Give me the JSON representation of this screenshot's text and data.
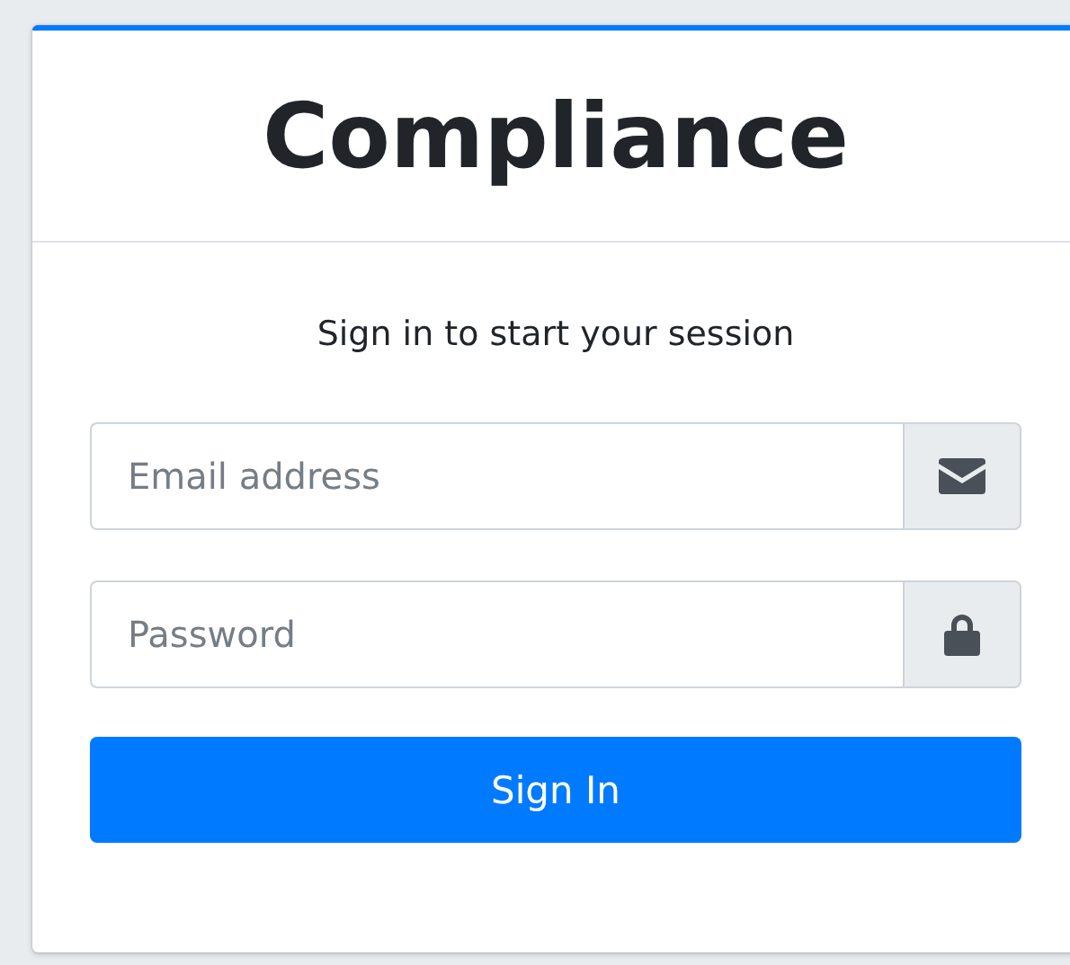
{
  "title": "Compliance",
  "message": "Sign in to start your session",
  "fields": [
    {
      "kind": "email",
      "placeholder": "Email address"
    },
    {
      "kind": "password",
      "placeholder": "Password"
    }
  ],
  "button": "Sign In"
}
